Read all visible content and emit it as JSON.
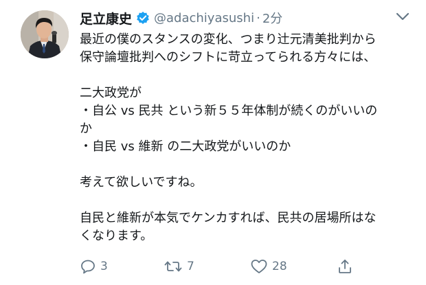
{
  "tweet": {
    "author": {
      "display_name": "足立康史",
      "handle": "@adachiyasushi",
      "verified": true
    },
    "separator": "·",
    "timestamp": "2分",
    "text_lines": [
      "最近の僕のスタンスの変化、つまり辻元清美批判から",
      "保守論壇批判へのシフトに苛立ってられる方々には、",
      "",
      "二大政党が",
      "・自公 vs 民共 という新５５年体制が続くのがいいの",
      "か",
      "・自民 vs 維新 の二大政党がいいのか",
      "",
      "考えて欲しいですね。",
      "",
      "自民と維新が本気でケンカすれば、民共の居場所はな",
      "くなります。"
    ],
    "actions": {
      "reply_count": "3",
      "retweet_count": "7",
      "like_count": "28"
    }
  },
  "colors": {
    "text": "#14171a",
    "secondary": "#657786",
    "verified": "#1da1f2"
  },
  "icons": [
    "avatar",
    "verified-badge-icon",
    "chevron-down-icon",
    "reply-icon",
    "retweet-icon",
    "like-icon",
    "share-icon"
  ]
}
